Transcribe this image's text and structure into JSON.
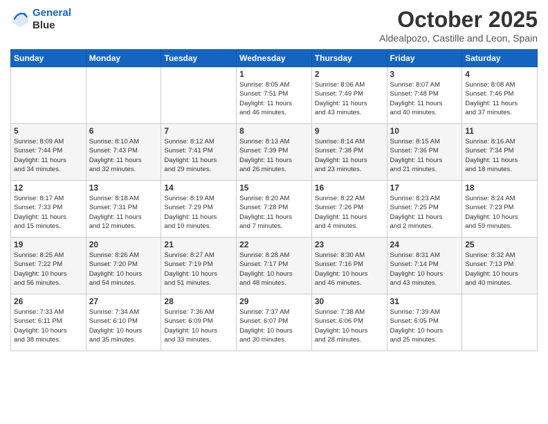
{
  "header": {
    "logo_line1": "General",
    "logo_line2": "Blue",
    "month_title": "October 2025",
    "location": "Aldealpozo, Castille and Leon, Spain"
  },
  "days_of_week": [
    "Sunday",
    "Monday",
    "Tuesday",
    "Wednesday",
    "Thursday",
    "Friday",
    "Saturday"
  ],
  "weeks": [
    [
      {
        "day": "",
        "info": ""
      },
      {
        "day": "",
        "info": ""
      },
      {
        "day": "",
        "info": ""
      },
      {
        "day": "1",
        "info": "Sunrise: 8:05 AM\nSunset: 7:51 PM\nDaylight: 11 hours\nand 46 minutes."
      },
      {
        "day": "2",
        "info": "Sunrise: 8:06 AM\nSunset: 7:49 PM\nDaylight: 11 hours\nand 43 minutes."
      },
      {
        "day": "3",
        "info": "Sunrise: 8:07 AM\nSunset: 7:48 PM\nDaylight: 11 hours\nand 40 minutes."
      },
      {
        "day": "4",
        "info": "Sunrise: 8:08 AM\nSunset: 7:46 PM\nDaylight: 11 hours\nand 37 minutes."
      }
    ],
    [
      {
        "day": "5",
        "info": "Sunrise: 8:09 AM\nSunset: 7:44 PM\nDaylight: 11 hours\nand 34 minutes."
      },
      {
        "day": "6",
        "info": "Sunrise: 8:10 AM\nSunset: 7:43 PM\nDaylight: 11 hours\nand 32 minutes."
      },
      {
        "day": "7",
        "info": "Sunrise: 8:12 AM\nSunset: 7:41 PM\nDaylight: 11 hours\nand 29 minutes."
      },
      {
        "day": "8",
        "info": "Sunrise: 8:13 AM\nSunset: 7:39 PM\nDaylight: 11 hours\nand 26 minutes."
      },
      {
        "day": "9",
        "info": "Sunrise: 8:14 AM\nSunset: 7:38 PM\nDaylight: 11 hours\nand 23 minutes."
      },
      {
        "day": "10",
        "info": "Sunrise: 8:15 AM\nSunset: 7:36 PM\nDaylight: 11 hours\nand 21 minutes."
      },
      {
        "day": "11",
        "info": "Sunrise: 8:16 AM\nSunset: 7:34 PM\nDaylight: 11 hours\nand 18 minutes."
      }
    ],
    [
      {
        "day": "12",
        "info": "Sunrise: 8:17 AM\nSunset: 7:33 PM\nDaylight: 11 hours\nand 15 minutes."
      },
      {
        "day": "13",
        "info": "Sunrise: 8:18 AM\nSunset: 7:31 PM\nDaylight: 11 hours\nand 12 minutes."
      },
      {
        "day": "14",
        "info": "Sunrise: 8:19 AM\nSunset: 7:29 PM\nDaylight: 11 hours\nand 10 minutes."
      },
      {
        "day": "15",
        "info": "Sunrise: 8:20 AM\nSunset: 7:28 PM\nDaylight: 11 hours\nand 7 minutes."
      },
      {
        "day": "16",
        "info": "Sunrise: 8:22 AM\nSunset: 7:26 PM\nDaylight: 11 hours\nand 4 minutes."
      },
      {
        "day": "17",
        "info": "Sunrise: 8:23 AM\nSunset: 7:25 PM\nDaylight: 11 hours\nand 2 minutes."
      },
      {
        "day": "18",
        "info": "Sunrise: 8:24 AM\nSunset: 7:23 PM\nDaylight: 10 hours\nand 59 minutes."
      }
    ],
    [
      {
        "day": "19",
        "info": "Sunrise: 8:25 AM\nSunset: 7:22 PM\nDaylight: 10 hours\nand 56 minutes."
      },
      {
        "day": "20",
        "info": "Sunrise: 8:26 AM\nSunset: 7:20 PM\nDaylight: 10 hours\nand 54 minutes."
      },
      {
        "day": "21",
        "info": "Sunrise: 8:27 AM\nSunset: 7:19 PM\nDaylight: 10 hours\nand 51 minutes."
      },
      {
        "day": "22",
        "info": "Sunrise: 8:28 AM\nSunset: 7:17 PM\nDaylight: 10 hours\nand 48 minutes."
      },
      {
        "day": "23",
        "info": "Sunrise: 8:30 AM\nSunset: 7:16 PM\nDaylight: 10 hours\nand 46 minutes."
      },
      {
        "day": "24",
        "info": "Sunrise: 8:31 AM\nSunset: 7:14 PM\nDaylight: 10 hours\nand 43 minutes."
      },
      {
        "day": "25",
        "info": "Sunrise: 8:32 AM\nSunset: 7:13 PM\nDaylight: 10 hours\nand 40 minutes."
      }
    ],
    [
      {
        "day": "26",
        "info": "Sunrise: 7:33 AM\nSunset: 6:11 PM\nDaylight: 10 hours\nand 38 minutes."
      },
      {
        "day": "27",
        "info": "Sunrise: 7:34 AM\nSunset: 6:10 PM\nDaylight: 10 hours\nand 35 minutes."
      },
      {
        "day": "28",
        "info": "Sunrise: 7:36 AM\nSunset: 6:09 PM\nDaylight: 10 hours\nand 33 minutes."
      },
      {
        "day": "29",
        "info": "Sunrise: 7:37 AM\nSunset: 6:07 PM\nDaylight: 10 hours\nand 30 minutes."
      },
      {
        "day": "30",
        "info": "Sunrise: 7:38 AM\nSunset: 6:06 PM\nDaylight: 10 hours\nand 28 minutes."
      },
      {
        "day": "31",
        "info": "Sunrise: 7:39 AM\nSunset: 6:05 PM\nDaylight: 10 hours\nand 25 minutes."
      },
      {
        "day": "",
        "info": ""
      }
    ]
  ]
}
